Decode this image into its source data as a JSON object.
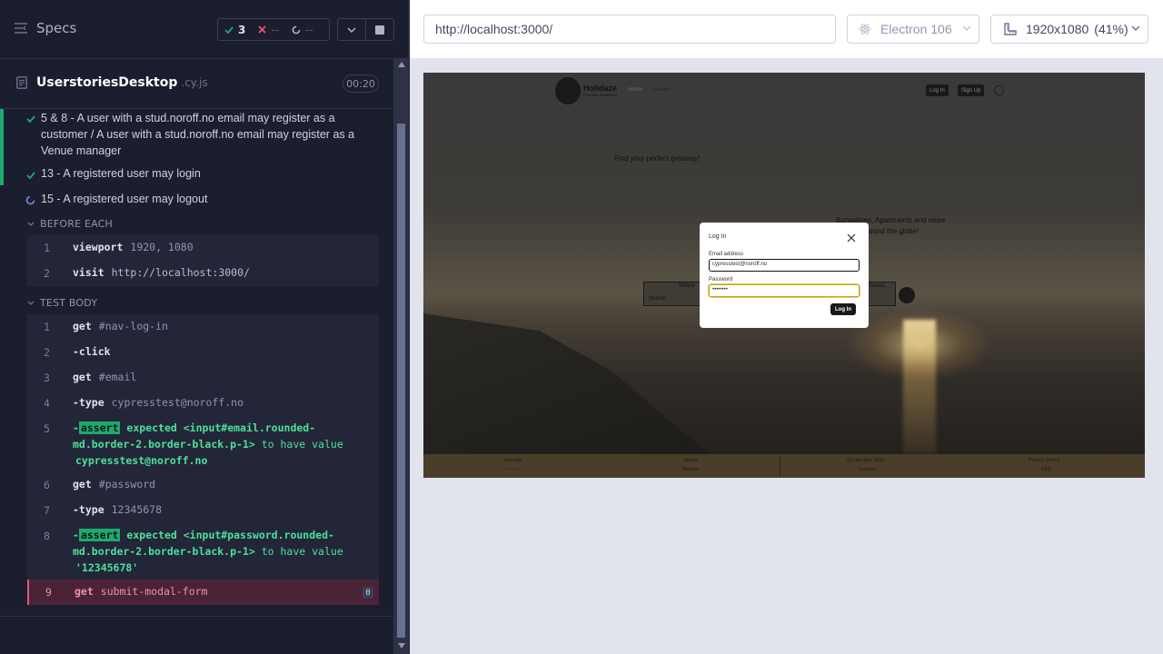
{
  "reporter": {
    "specs_label": "Specs",
    "stats": {
      "passed": "3",
      "failed": "--",
      "pending": "--"
    },
    "file": {
      "name": "UserstoriesDesktop",
      "ext": ".cy.js",
      "duration": "00:20"
    },
    "tests": [
      {
        "title": "5 & 8 - A user with a stud.noroff.no email may register as a customer / A user with a stud.noroff.no email may register as a Venue manager",
        "state": "passed"
      },
      {
        "title": "13 - A registered user may login",
        "state": "passed"
      },
      {
        "title": "15 - A registered user may logout",
        "state": "running"
      }
    ],
    "before_each_label": "BEFORE EACH",
    "before_each": [
      {
        "n": "1",
        "name": "viewport",
        "arg": "1920, 1080"
      },
      {
        "n": "2",
        "name": "visit",
        "arg": "http://localhost:3000/"
      }
    ],
    "test_body_label": "TEST BODY",
    "test_body": [
      {
        "n": "1",
        "name": "get",
        "arg": "#nav-log-in"
      },
      {
        "n": "2",
        "name": "-click",
        "arg": ""
      },
      {
        "n": "3",
        "name": "get",
        "arg": "#email"
      },
      {
        "n": "4",
        "name": "-type",
        "arg": "cypresstest@noroff.no"
      },
      {
        "n": "5",
        "prefix": "-",
        "badge": "assert",
        "line1": "expected",
        "line1b": "<input#email.rounded-",
        "line2": "md.border-2.border-black.p-1>",
        "line2b": "to have value",
        "line3": "cypresstest@noroff.no"
      },
      {
        "n": "6",
        "name": "get",
        "arg": "#password"
      },
      {
        "n": "7",
        "name": "-type",
        "arg": "12345678"
      },
      {
        "n": "8",
        "prefix": "-",
        "badge": "assert",
        "line1": "expected",
        "line1b": "<input#password.rounded-",
        "line2": "md.border-2.border-black.p-1>",
        "line2b": "to have value",
        "line3": "'12345678'"
      },
      {
        "n": "9",
        "name": "get",
        "arg": "submit-modal-form",
        "count": "0"
      }
    ]
  },
  "aut": {
    "url": "http://localhost:3000/",
    "browser": "Electron 106",
    "viewport": "1920x1080",
    "scale": "(41%)",
    "site": {
      "logo_text": "Holidaze",
      "logo_sub": "Find your dreamland",
      "nav_home": "Home",
      "nav_venues": "Venues",
      "btn_login": "Log In",
      "btn_signup": "Sign Up",
      "tagline": "Find your perfect getaway!",
      "hero_line1": "Bungalows, Apartments and more",
      "hero_line2": "around the globe!",
      "where_label": "Where",
      "search_placeholder": "Search",
      "guests_label": "Guests",
      "footer": {
        "sitemap": "Sitemap",
        "account": "Account",
        "home": "Home",
        "venues": "Venues",
        "copyright": "©Copyright 2023",
        "cookies": "Cookies",
        "privacy": "Privacy Policy",
        "faq": "FAQ"
      },
      "modal": {
        "title": "Log In",
        "email_label": "Email address",
        "email_value": "cypresstest@noroff.no",
        "password_label": "Password",
        "password_value": "••••••••",
        "submit_label": "Log In"
      }
    }
  },
  "colors": {
    "pass": "#1fa971",
    "fail": "#e45770",
    "running": "#6e7bd9"
  }
}
